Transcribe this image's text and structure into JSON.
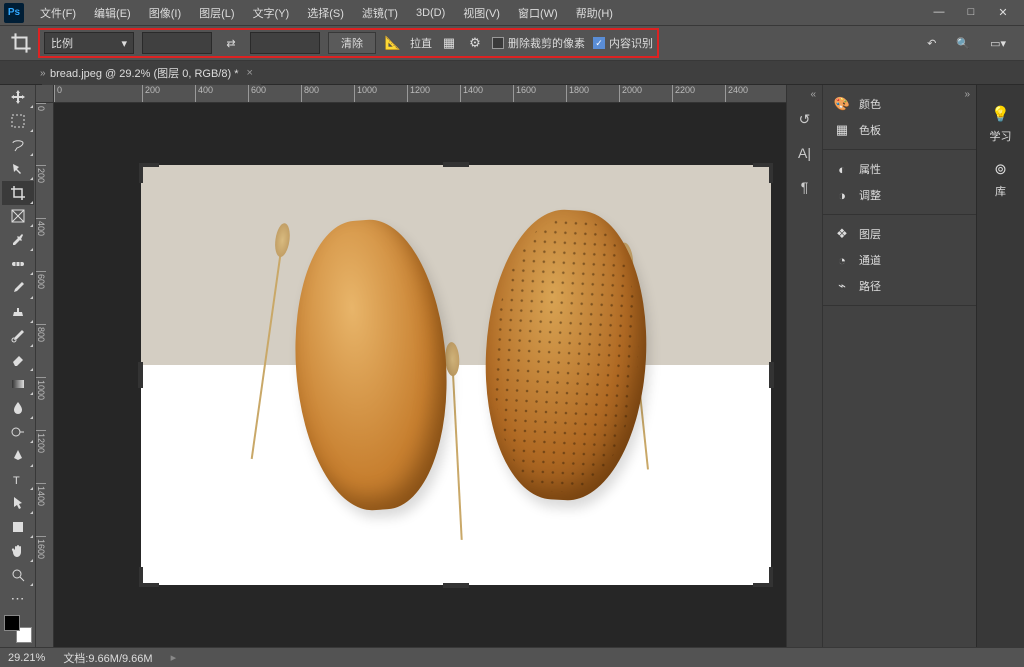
{
  "menu": [
    "文件(F)",
    "编辑(E)",
    "图像(I)",
    "图层(L)",
    "文字(Y)",
    "选择(S)",
    "滤镜(T)",
    "3D(D)",
    "视图(V)",
    "窗口(W)",
    "帮助(H)"
  ],
  "options": {
    "ratio_label": "比例",
    "clear": "清除",
    "straighten": "拉直",
    "delete_cropped": "删除裁剪的像素",
    "content_aware": "内容识别"
  },
  "doc_tab": "bread.jpeg @ 29.2% (图层 0, RGB/8) *",
  "ruler_h": [
    "0",
    "200",
    "400",
    "600",
    "800",
    "1000",
    "1200",
    "1400",
    "1600",
    "1800",
    "2000",
    "2200",
    "2400"
  ],
  "ruler_v": [
    "0",
    "200",
    "400",
    "600",
    "800",
    "1000",
    "1200",
    "1400",
    "1600"
  ],
  "panels": {
    "color": "颜色",
    "swatches": "色板",
    "properties": "属性",
    "adjustments": "调整",
    "layers": "图层",
    "channels": "通道",
    "paths": "路径"
  },
  "right": {
    "learn": "学习",
    "libraries": "库"
  },
  "status": {
    "zoom": "29.21%",
    "doc_label": "文档:",
    "doc_size": "9.66M/9.66M"
  }
}
